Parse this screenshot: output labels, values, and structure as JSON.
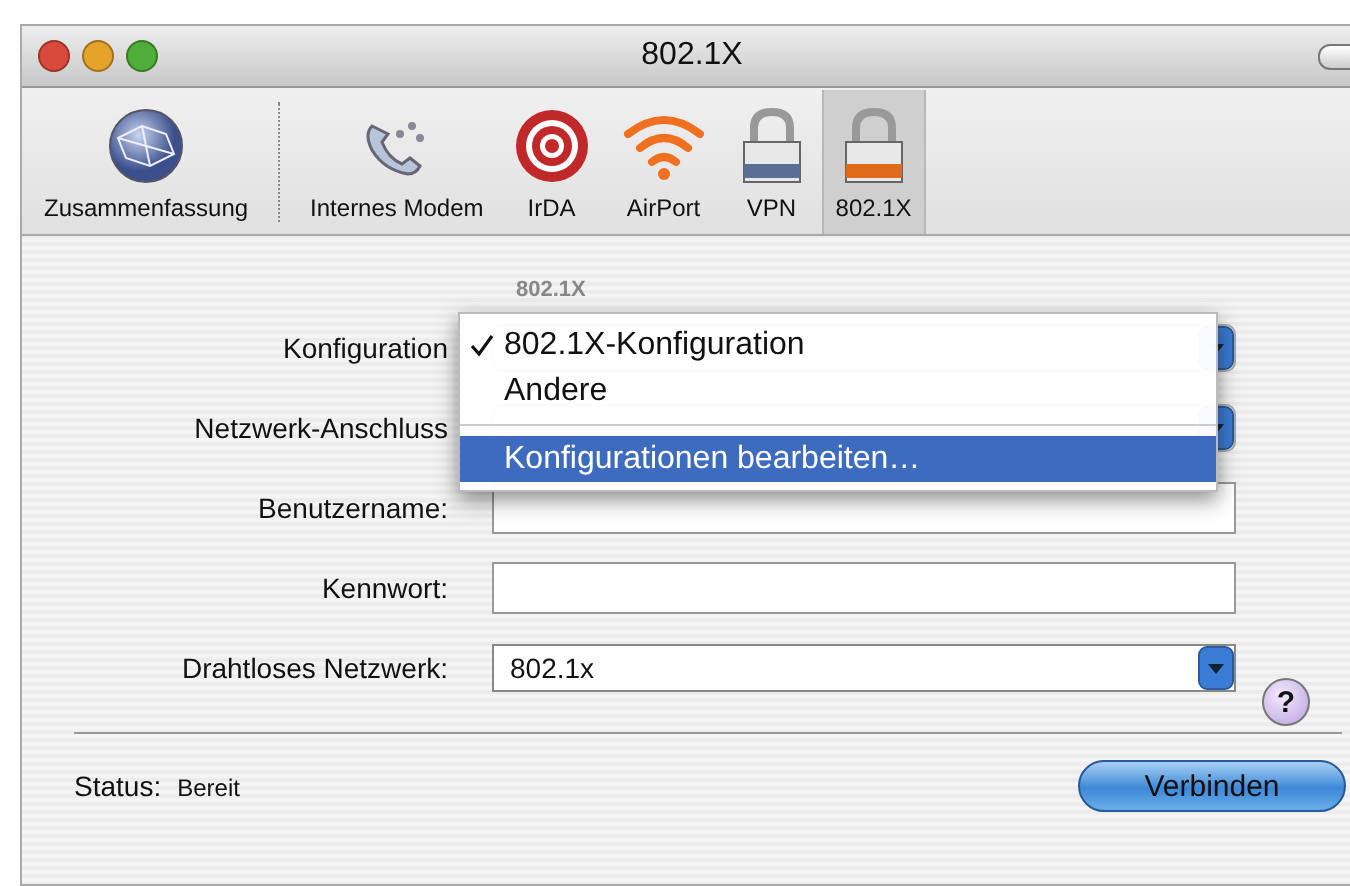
{
  "window": {
    "title": "802.1X"
  },
  "toolbar": [
    {
      "label": "Zusammenfassung",
      "kind": "globe",
      "selected": false
    },
    {
      "label": "Internes Modem",
      "kind": "phone",
      "selected": false
    },
    {
      "label": "IrDA",
      "kind": "target",
      "selected": false
    },
    {
      "label": "AirPort",
      "kind": "wifi",
      "selected": false
    },
    {
      "label": "VPN",
      "kind": "lock-blue",
      "selected": false
    },
    {
      "label": "802.1X",
      "kind": "lock-orange",
      "selected": true
    }
  ],
  "section_label": "802.1X",
  "fields": [
    {
      "label": "Konfiguration",
      "kind": "popup"
    },
    {
      "label": "Netzwerk-Anschluss",
      "kind": "popup"
    },
    {
      "label": "Benutzername:",
      "kind": "text"
    },
    {
      "label": "Kennwort:",
      "kind": "text"
    },
    {
      "label": "Drahtloses Netzwerk:",
      "kind": "combo",
      "value": "802.1x"
    }
  ],
  "help": "?",
  "menu": [
    {
      "kind": "item",
      "label": "802.1X-Konfiguration",
      "checked": true,
      "selected": false
    },
    {
      "kind": "item",
      "label": "Andere",
      "checked": false,
      "selected": false
    },
    {
      "kind": "separator"
    },
    {
      "kind": "item",
      "label": "Konfigurationen bearbeiten…",
      "checked": false,
      "selected": true
    }
  ],
  "status": {
    "label": "Status:",
    "value": "Bereit"
  },
  "button": "Verbinden"
}
